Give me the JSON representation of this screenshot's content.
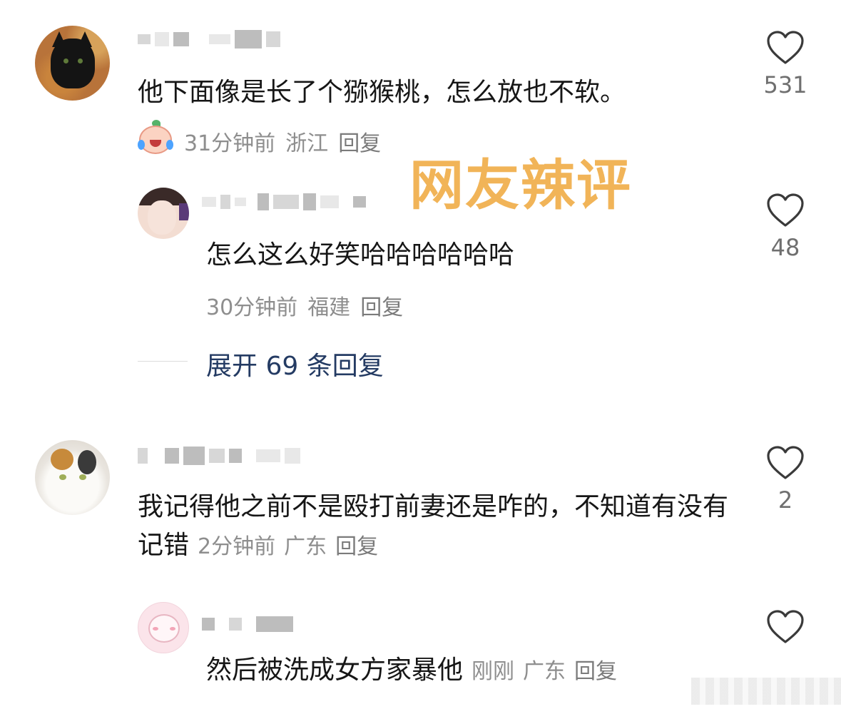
{
  "overlay": {
    "title": "网友辣评"
  },
  "comments": [
    {
      "text": "他下面像是长了个猕猴桃，怎么放也不软。",
      "time": "31分钟前",
      "location": "浙江",
      "reply": "回复",
      "likes": "531",
      "avatar_icon": "black-cat-avatar",
      "sticker_icon": "crying-laughing-peach-sticker"
    },
    {
      "text": "怎么这么好笑哈哈哈哈哈哈",
      "time": "30分钟前",
      "location": "福建",
      "reply": "回复",
      "likes": "48",
      "avatar_icon": "girl-avatar"
    },
    {
      "text": "我记得他之前不是殴打前妻还是咋的，不知道有没有记错",
      "time": "2分钟前",
      "location": "广东",
      "reply": "回复",
      "likes": "2",
      "avatar_icon": "calico-cat-avatar"
    },
    {
      "text": "然后被洗成女方家暴他",
      "time": "刚刚",
      "location": "广东",
      "reply": "回复",
      "avatar_icon": "pink-cartoon-avatar"
    }
  ],
  "expand_replies": "展开 69 条回复",
  "colors": {
    "overlay_title": "#f1b458",
    "expand_link": "#243b63",
    "meta_text": "#8e8e8e",
    "comment_text": "#161616"
  }
}
